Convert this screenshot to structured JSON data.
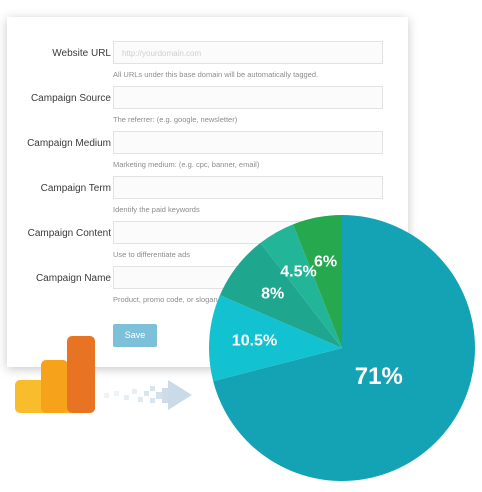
{
  "form": {
    "fields": [
      {
        "label": "Website URL",
        "placeholder": "http://yourdomain.com",
        "help": "All URLs under this base domain will be automatically tagged."
      },
      {
        "label": "Campaign Source",
        "placeholder": "",
        "help": "The referrer: (e.g. google, newsletter)"
      },
      {
        "label": "Campaign Medium",
        "placeholder": "",
        "help": "Marketing medium: (e.g. cpc, banner, email)"
      },
      {
        "label": "Campaign Term",
        "placeholder": "",
        "help": "Identify the paid keywords"
      },
      {
        "label": "Campaign Content",
        "placeholder": "",
        "help": "Use to differentiate ads"
      },
      {
        "label": "Campaign Name",
        "placeholder": "",
        "help": "Product, promo code, or slogan"
      }
    ],
    "save_label": "Save"
  },
  "logo": {
    "name": "google-analytics-logo",
    "colors": {
      "light": "#F9BC2C",
      "dark": "#E87423"
    }
  },
  "arrow": {
    "name": "right-arrow-icon",
    "color": "#c9dbe8"
  },
  "chart_data": {
    "type": "pie",
    "slices": [
      {
        "label": "71%",
        "value": 71,
        "color": "#14A3B5"
      },
      {
        "label": "10.5%",
        "value": 10.5,
        "color": "#12C2D0"
      },
      {
        "label": "8%",
        "value": 8,
        "color": "#1FA68F"
      },
      {
        "label": "4.5%",
        "value": 4.5,
        "color": "#22B598"
      },
      {
        "label": "6%",
        "value": 6,
        "color": "#26A84E"
      }
    ]
  }
}
